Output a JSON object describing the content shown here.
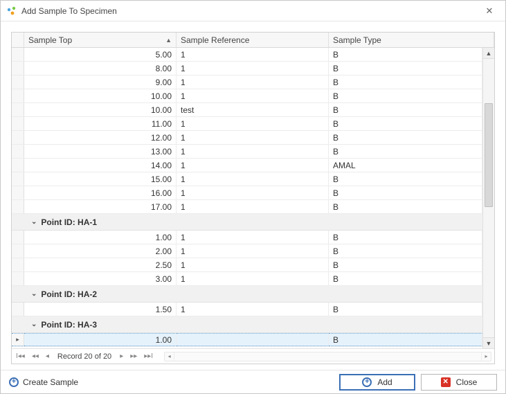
{
  "window": {
    "title": "Add Sample To Specimen"
  },
  "columns": {
    "top": "Sample Top",
    "ref": "Sample Reference",
    "type": "Sample Type"
  },
  "rows_top": [
    {
      "top": "5.00",
      "ref": "1",
      "type": "B"
    },
    {
      "top": "8.00",
      "ref": "1",
      "type": "B"
    },
    {
      "top": "9.00",
      "ref": "1",
      "type": "B"
    },
    {
      "top": "10.00",
      "ref": "1",
      "type": "B"
    },
    {
      "top": "10.00",
      "ref": "test",
      "type": "B"
    },
    {
      "top": "11.00",
      "ref": "1",
      "type": "B"
    },
    {
      "top": "12.00",
      "ref": "1",
      "type": "B"
    },
    {
      "top": "13.00",
      "ref": "1",
      "type": "B"
    },
    {
      "top": "14.00",
      "ref": "1",
      "type": "AMAL"
    },
    {
      "top": "15.00",
      "ref": "1",
      "type": "B"
    },
    {
      "top": "16.00",
      "ref": "1",
      "type": "B"
    },
    {
      "top": "17.00",
      "ref": "1",
      "type": "B"
    }
  ],
  "groups": [
    {
      "label": "Point ID: HA-1",
      "rows": [
        {
          "top": "1.00",
          "ref": "1",
          "type": "B"
        },
        {
          "top": "2.00",
          "ref": "1",
          "type": "B"
        },
        {
          "top": "2.50",
          "ref": "1",
          "type": "B"
        },
        {
          "top": "3.00",
          "ref": "1",
          "type": "B"
        }
      ]
    },
    {
      "label": "Point ID: HA-2",
      "rows": [
        {
          "top": "1.50",
          "ref": "1",
          "type": "B"
        }
      ]
    },
    {
      "label": "Point ID: HA-3",
      "rows": [
        {
          "top": "1.00",
          "ref": "",
          "type": "B",
          "selected": true
        }
      ]
    }
  ],
  "pager": {
    "text": "Record 20 of 20"
  },
  "buttons": {
    "create": "Create Sample",
    "add": "Add",
    "close": "Close"
  }
}
